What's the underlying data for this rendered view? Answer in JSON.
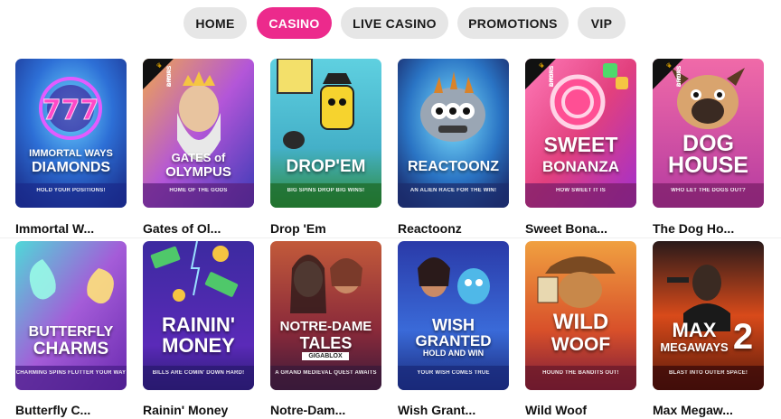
{
  "nav": {
    "items": [
      {
        "label": "HOME",
        "active": false
      },
      {
        "label": "CASINO",
        "active": true
      },
      {
        "label": "LIVE CASINO",
        "active": false
      },
      {
        "label": "PROMOTIONS",
        "active": false
      },
      {
        "label": "VIP",
        "active": false
      }
    ]
  },
  "badge": {
    "line1": "DROPS",
    "line2": "& WINS"
  },
  "games": [
    {
      "title": "Immortal W...",
      "art_line1": "IMMORTAL WAYS",
      "art_line2": "DIAMONDS",
      "tagline": "HOLD YOUR POSITIONS!",
      "drops": false
    },
    {
      "title": "Gates of Ol...",
      "art_line1": "GATES of",
      "art_line2": "OLYMPUS",
      "tagline": "HOME OF THE GODS",
      "drops": true
    },
    {
      "title": "Drop 'Em",
      "art_line1": "",
      "art_line2": "DROP'EM",
      "tagline": "BIG SPINS DROP BIG WINS!",
      "drops": false
    },
    {
      "title": "Reactoonz",
      "art_line1": "",
      "art_line2": "REACTOONZ",
      "tagline": "AN ALIEN RACE FOR THE WIN!",
      "drops": false
    },
    {
      "title": "Sweet Bona...",
      "art_line1": "SWEET",
      "art_line2": "BONANZA",
      "tagline": "HOW SWEET IT IS",
      "drops": true
    },
    {
      "title": "The Dog Ho...",
      "art_line1": "DOG",
      "art_line2": "HOUSE",
      "tagline": "WHO LET THE DOGS OUT?",
      "drops": true
    },
    {
      "title": "Butterfly C...",
      "art_line1": "BUTTERFLY",
      "art_line2": "CHARMS",
      "tagline": "CHARMING SPINS FLUTTER YOUR WAY",
      "drops": false
    },
    {
      "title": "Rainin' Money",
      "art_line1": "RAININ'",
      "art_line2": "MONEY",
      "tagline": "BILLS ARE COMIN' DOWN HARD!",
      "drops": false
    },
    {
      "title": "Notre-Dam...",
      "art_line1": "NOTRE-DAME",
      "art_line2": "TALES",
      "art_line3": "GIGABLOX",
      "tagline": "A GRAND MEDIEVAL QUEST AWAITS",
      "drops": false
    },
    {
      "title": "Wish Grant...",
      "art_line1": "WISH",
      "art_line2": "GRANTED",
      "art_line3": "HOLD AND WIN",
      "tagline": "YOUR WISH COMES TRUE",
      "drops": false
    },
    {
      "title": "Wild Woof",
      "art_line1": "WILD",
      "art_line2": "WOOF",
      "tagline": "HOUND THE BANDITS OUT!",
      "drops": false
    },
    {
      "title": "Max Megaw...",
      "art_line1": "MAX",
      "art_line2": "MEGAWAYS",
      "art_line3": "2",
      "tagline": "BLAST INTO OUTER SPACE!",
      "drops": false
    }
  ],
  "colors": {
    "accent": "#ec2a8c",
    "pill": "#e6e6e6",
    "text": "#111111"
  }
}
